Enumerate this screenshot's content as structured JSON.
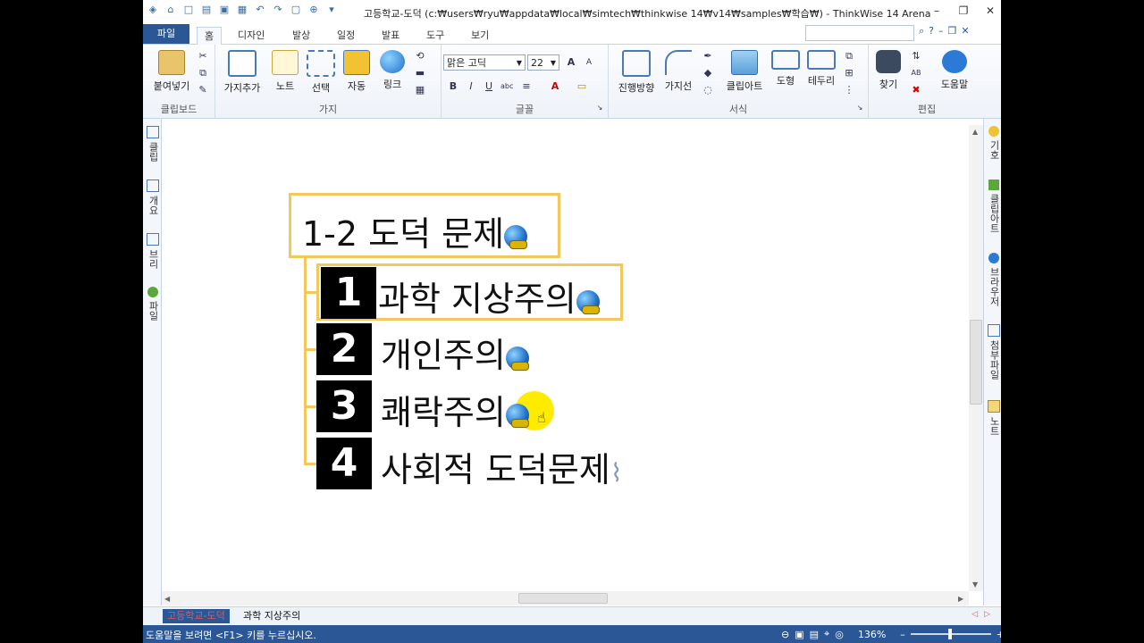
{
  "window": {
    "title": "고등학교-도덕 (c:₩users₩ryu₩appdata₩local₩simtech₩thinkwise 14₩v14₩samples₩학습₩) - ThinkWise 14 Arena"
  },
  "menu": {
    "file": "파일",
    "tabs": [
      "홈",
      "디자인",
      "발상",
      "일정",
      "발표",
      "도구",
      "보기"
    ]
  },
  "ribbon": {
    "clipboard": {
      "paste": "붙여넣기",
      "group": "클립보드"
    },
    "branch": {
      "add": "가지추가",
      "note": "노트",
      "select": "선택",
      "auto": "자동",
      "link": "링크",
      "group": "가지"
    },
    "font": {
      "face": "맑은 고딕",
      "size": "22",
      "group": "글꼴"
    },
    "format": {
      "direction": "진행방향",
      "line": "가지선",
      "clipart": "클립아트",
      "shape": "도형",
      "border": "테두리",
      "group": "서식"
    },
    "edit": {
      "find": "찾기",
      "help": "도움말",
      "group": "편집"
    }
  },
  "left_panel": [
    "클립",
    "개요",
    "브리",
    "파일"
  ],
  "right_panel": [
    "기호",
    "클립아트",
    "브라우저",
    "첨부파일",
    "노트"
  ],
  "map": {
    "root": "1-2 도덕 문제",
    "children": [
      {
        "num": "1",
        "text": "과학 지상주의"
      },
      {
        "num": "2",
        "text": "개인주의"
      },
      {
        "num": "3",
        "text": "쾌락주의"
      },
      {
        "num": "4",
        "text": "사회적 도덕문제"
      }
    ]
  },
  "sheets": {
    "active": "고등학교-도덕",
    "other": "과학 지상주의"
  },
  "status": {
    "help": "도움말을 보려면 <F1> 키를 누르십시오.",
    "zoom": "136%"
  }
}
